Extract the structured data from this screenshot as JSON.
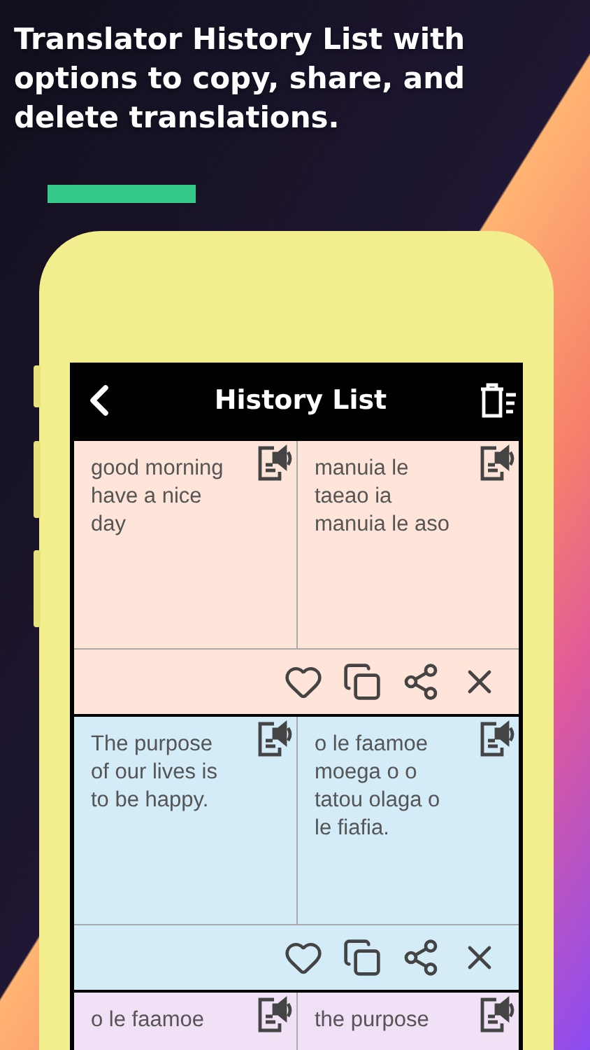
{
  "headline": "Translator History List with options to copy, share, and delete translations.",
  "screen": {
    "title": "History List",
    "cards": [
      {
        "color": "#ffe4d9",
        "source": "good morning have a nice day",
        "target": "manuia le taeao ia manuia le aso",
        "actions_shown": true
      },
      {
        "color": "#d4ecf8",
        "source": "The purpose of our lives is to be happy.",
        "target": "o le faamoe moega o o tatou olaga o le fiafia.",
        "actions_shown": true
      },
      {
        "color": "#f1e1f6",
        "source": "o le faamoe",
        "target": "the purpose",
        "actions_shown": false
      }
    ]
  }
}
